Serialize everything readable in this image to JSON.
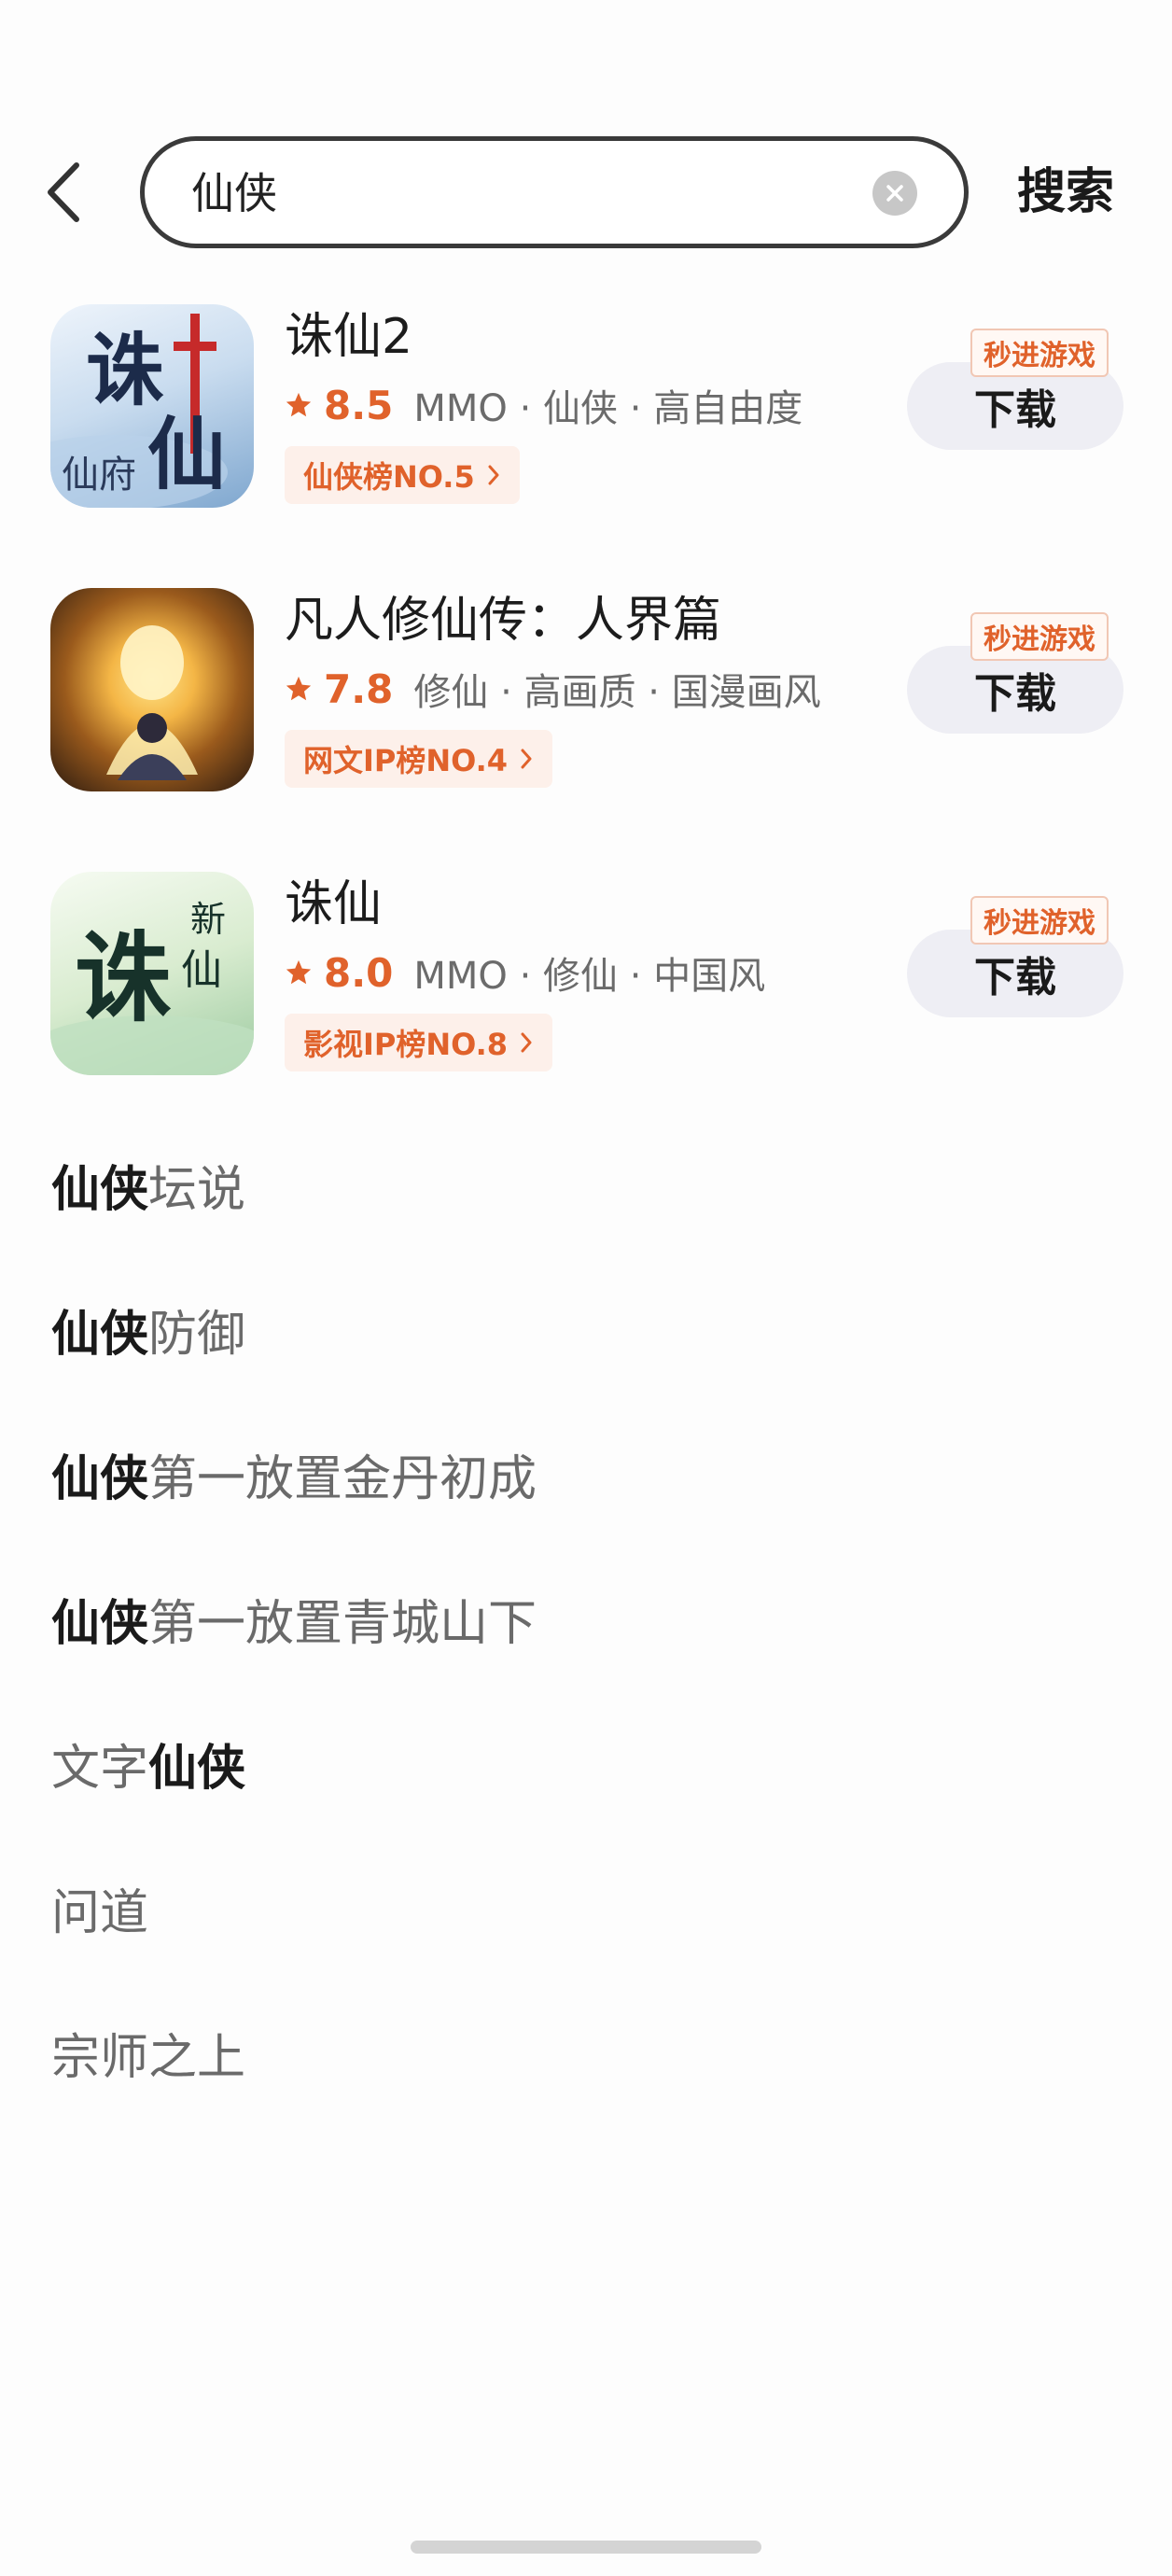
{
  "search": {
    "query": "仙侠",
    "button_label": "搜索"
  },
  "games": [
    {
      "name": "诛仙2",
      "rating": "8.5",
      "tags": "MMO · 仙侠 · 高自由度",
      "rank": "仙侠榜NO.5",
      "quick_tag": "秒进游戏",
      "download": "下载",
      "icon_text": [
        "诛",
        "仙",
        "仙府"
      ]
    },
    {
      "name": "凡人修仙传：人界篇",
      "rating": "7.8",
      "tags": "修仙 · 高画质 · 国漫画风",
      "rank": "网文IP榜NO.4",
      "quick_tag": "秒进游戏",
      "download": "下载"
    },
    {
      "name": "诛仙",
      "rating": "8.0",
      "tags": "MMO · 修仙 · 中国风",
      "rank": "影视IP榜NO.8",
      "quick_tag": "秒进游戏",
      "download": "下载",
      "icon_text": [
        "诛",
        "新",
        "仙"
      ]
    }
  ],
  "suggestions": [
    {
      "pre": "",
      "hl": "仙侠",
      "post": "坛说"
    },
    {
      "pre": "",
      "hl": "仙侠",
      "post": "防御"
    },
    {
      "pre": "",
      "hl": "仙侠",
      "post": "第一放置金丹初成"
    },
    {
      "pre": "",
      "hl": "仙侠",
      "post": "第一放置青城山下"
    },
    {
      "pre": "文字",
      "hl": "仙侠",
      "post": ""
    },
    {
      "pre": "问道",
      "hl": "",
      "post": ""
    },
    {
      "pre": "宗师之上",
      "hl": "",
      "post": ""
    }
  ],
  "colors": {
    "accent": "#e0622b",
    "badge_bg": "#fdf0ea",
    "download_bg": "#eeeef4"
  },
  "icons": [
    "back-arrow-icon",
    "clear-icon",
    "star-icon",
    "chevron-right-icon"
  ]
}
